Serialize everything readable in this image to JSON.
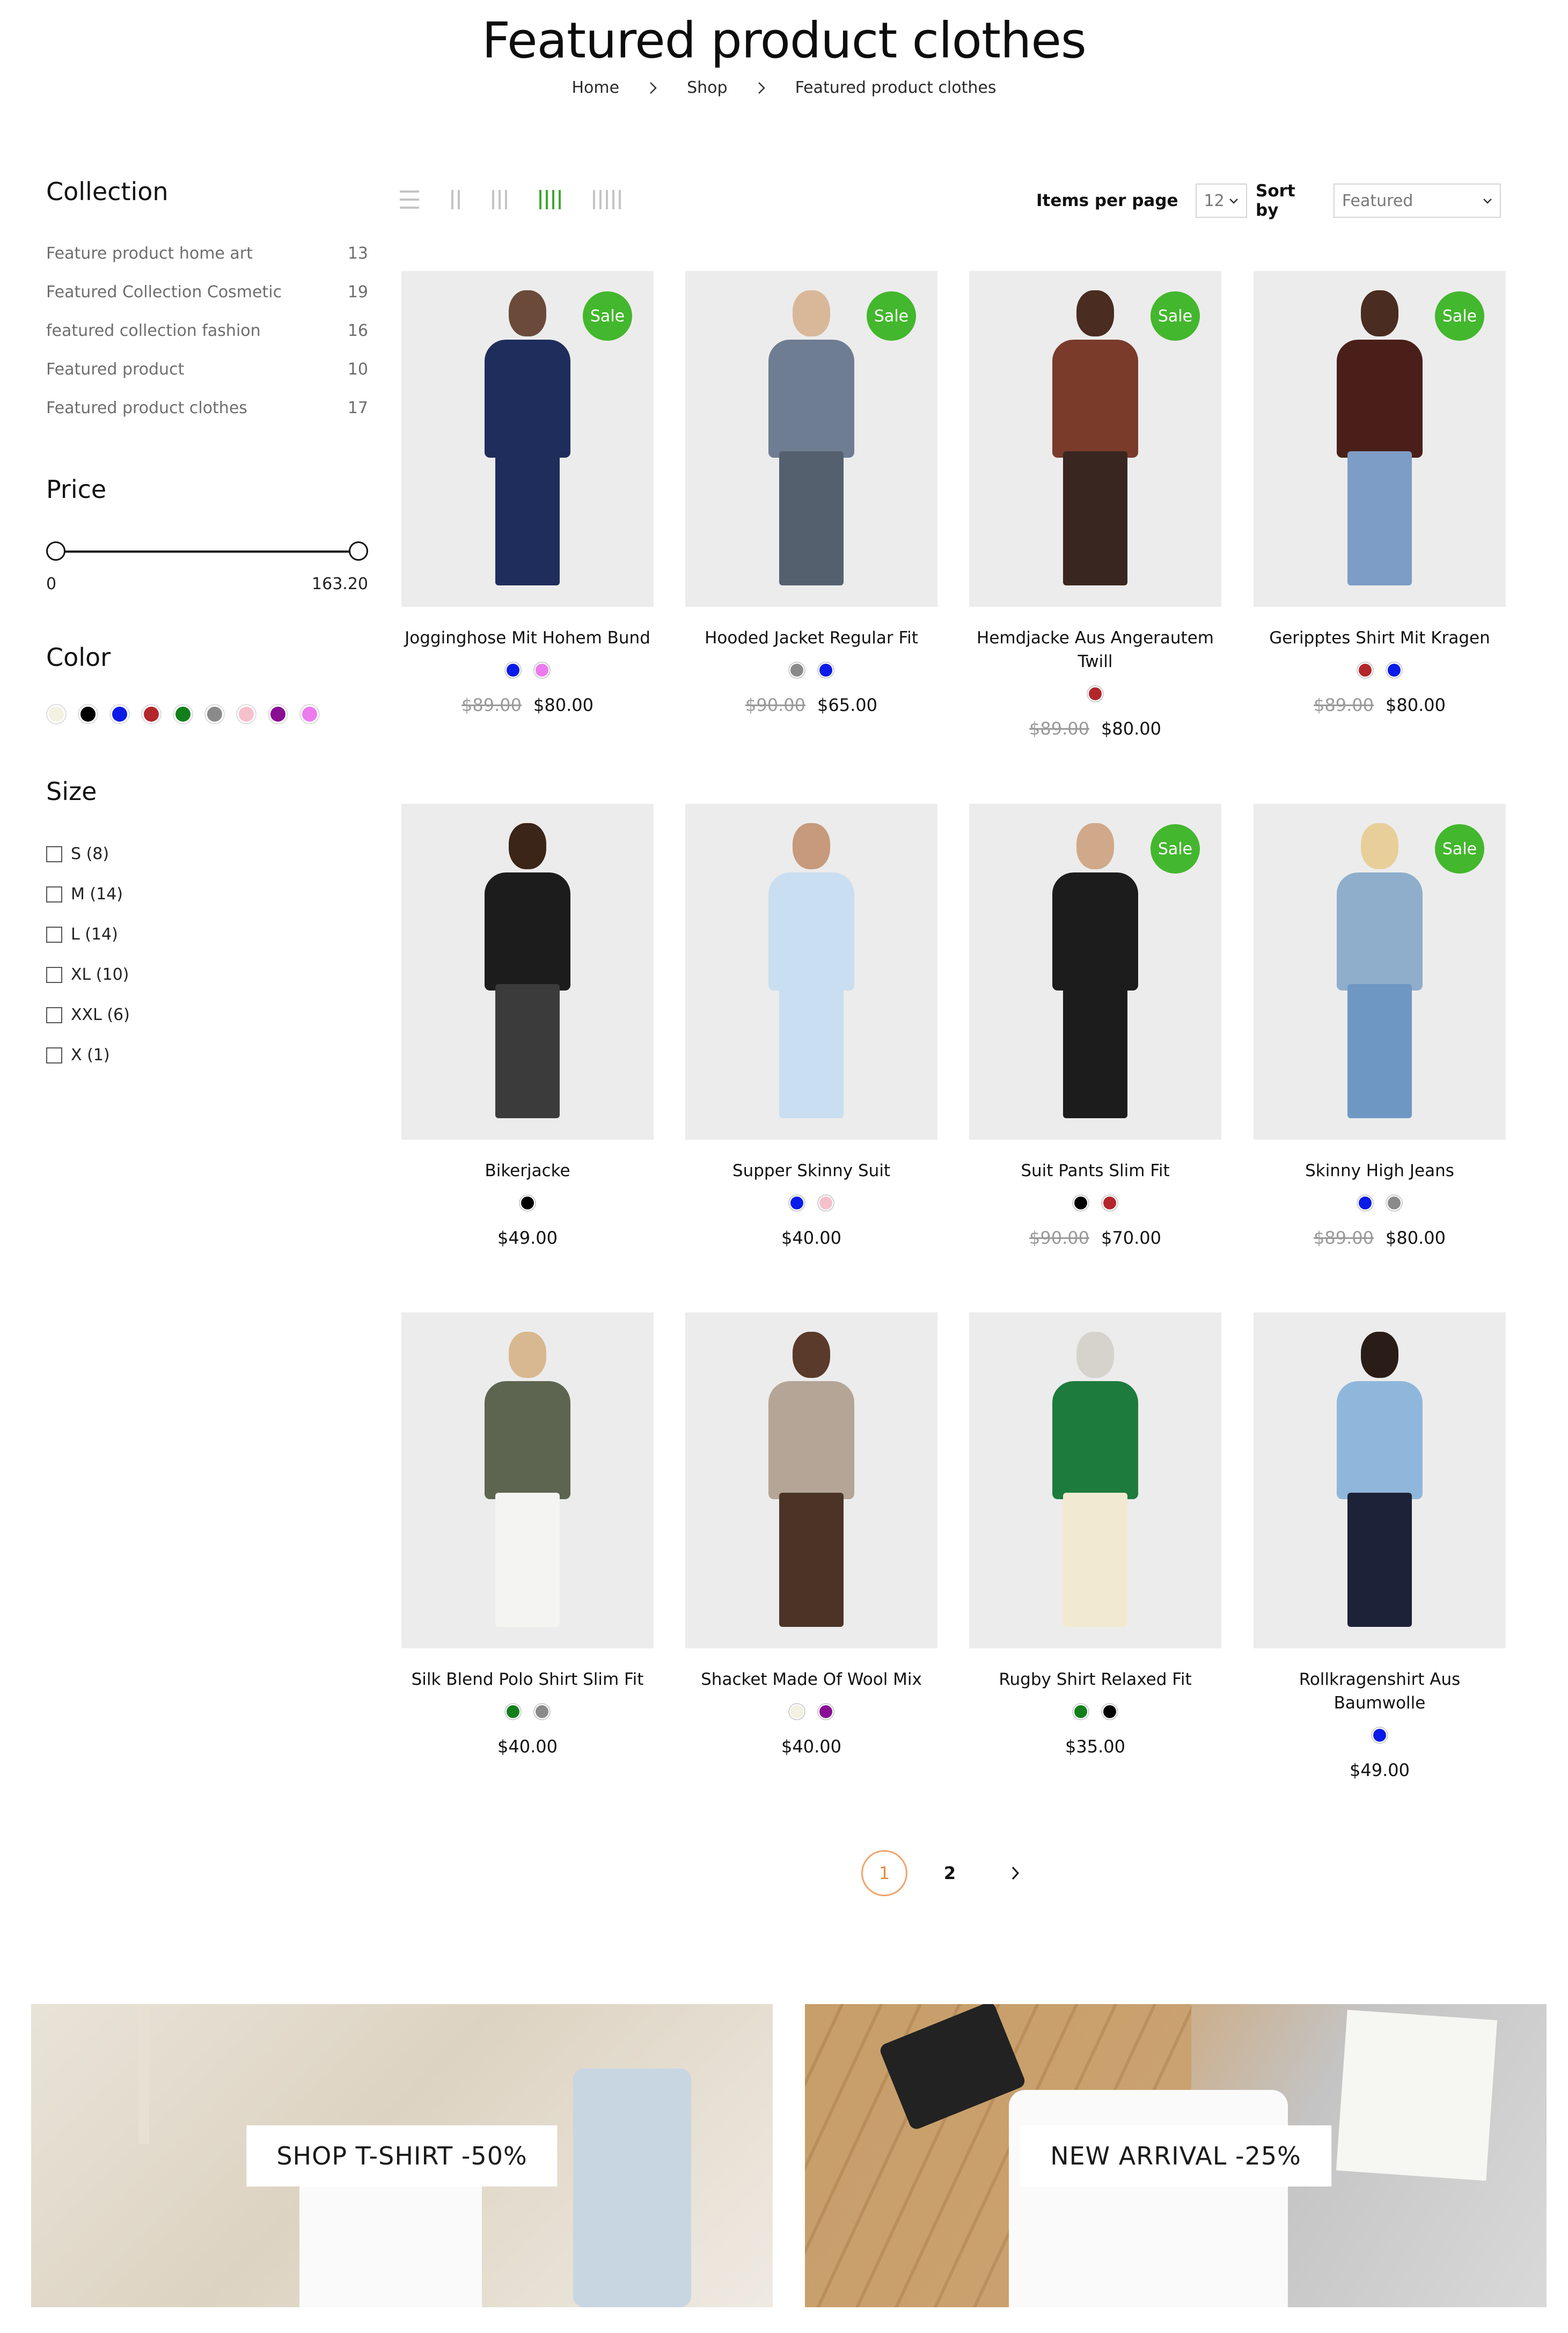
{
  "header": {
    "title": "Featured product clothes",
    "breadcrumb": [
      "Home",
      "Shop",
      "Featured product clothes"
    ]
  },
  "sidebar": {
    "collection": {
      "heading": "Collection",
      "items": [
        {
          "label": "Feature product home art",
          "count": "13"
        },
        {
          "label": "Featured Collection Cosmetic",
          "count": "19"
        },
        {
          "label": "featured collection fashion",
          "count": "16"
        },
        {
          "label": "Featured product",
          "count": "10"
        },
        {
          "label": "Featured product clothes",
          "count": "17"
        }
      ]
    },
    "price": {
      "heading": "Price",
      "min": "0",
      "max": "163.20"
    },
    "color": {
      "heading": "Color",
      "swatches": [
        "#f3f1df",
        "#000000",
        "#0a1be8",
        "#b3262b",
        "#11801a",
        "#8a8a8a",
        "#f6bfcc",
        "#8a0d93",
        "#ec7bee"
      ]
    },
    "size": {
      "heading": "Size",
      "items": [
        "S (8)",
        "M (14)",
        "L (14)",
        "XL (10)",
        "XXL (6)",
        "X (1)"
      ]
    }
  },
  "toolbar": {
    "items_per_page_label": "Items per page",
    "items_per_page_value": "12",
    "sort_label": "Sort by",
    "sort_value": "Featured",
    "active_view": "4-columns",
    "accent": "#3ca82e"
  },
  "products": [
    {
      "name": "Jogginghose Mit Hohem Bund",
      "sale": "Sale",
      "old_price": "$89.00",
      "price": "$80.00",
      "swatches": [
        "#0a1be8",
        "#ec7bee"
      ],
      "palette": [
        "#6b4a3a",
        "#1f2d5c",
        "#1f2d5c"
      ]
    },
    {
      "name": "Hooded Jacket Regular Fit",
      "sale": "Sale",
      "old_price": "$90.00",
      "price": "$65.00",
      "swatches": [
        "#8a8a8a",
        "#0a1be8"
      ],
      "palette": [
        "#d9b89a",
        "#6f7d92",
        "#55606f"
      ]
    },
    {
      "name": "Hemdjacke Aus Angerautem Twill",
      "sale": "Sale",
      "old_price": "$89.00",
      "price": "$80.00",
      "swatches": [
        "#b3262b"
      ],
      "palette": [
        "#4a2c20",
        "#7a3b2a",
        "#3a2620"
      ]
    },
    {
      "name": "Geripptes Shirt Mit Kragen",
      "sale": "Sale",
      "old_price": "$89.00",
      "price": "$80.00",
      "swatches": [
        "#b3262b",
        "#0a1be8"
      ],
      "palette": [
        "#4a2c20",
        "#4a1f1a",
        "#7d9cc6"
      ]
    },
    {
      "name": "Bikerjacke",
      "sale": "",
      "old_price": "",
      "price": "$49.00",
      "swatches": [
        "#000000"
      ],
      "palette": [
        "#3b2418",
        "#1c1c1c",
        "#3b3b3b"
      ]
    },
    {
      "name": "Supper Skinny Suit",
      "sale": "",
      "old_price": "",
      "price": "$40.00",
      "swatches": [
        "#0a1be8",
        "#f6bfcc"
      ],
      "palette": [
        "#c69a7b",
        "#c9def0",
        "#c9def0"
      ]
    },
    {
      "name": "Suit Pants Slim Fit",
      "sale": "Sale",
      "old_price": "$90.00",
      "price": "$70.00",
      "swatches": [
        "#000000",
        "#b3262b"
      ],
      "palette": [
        "#d0a98a",
        "#1c1c1c",
        "#1c1c1c"
      ]
    },
    {
      "name": "Skinny High Jeans",
      "sale": "Sale",
      "old_price": "$89.00",
      "price": "$80.00",
      "swatches": [
        "#0a1be8",
        "#8a8a8a"
      ],
      "palette": [
        "#e8cf9a",
        "#8eaecb",
        "#6f97c4"
      ]
    },
    {
      "name": "Silk Blend Polo Shirt Slim Fit",
      "sale": "",
      "old_price": "",
      "price": "$40.00",
      "swatches": [
        "#11801a",
        "#8a8a8a"
      ],
      "palette": [
        "#d8b890",
        "#5d6450",
        "#f4f4f2"
      ]
    },
    {
      "name": "Shacket Made Of Wool Mix",
      "sale": "",
      "old_price": "",
      "price": "$40.00",
      "swatches": [
        "#f3f1df",
        "#8a0d93"
      ],
      "palette": [
        "#5a3a2a",
        "#b4a596",
        "#4b3426"
      ]
    },
    {
      "name": "Rugby Shirt Relaxed Fit",
      "sale": "",
      "old_price": "",
      "price": "$35.00",
      "swatches": [
        "#11801a",
        "#000000"
      ],
      "palette": [
        "#d6d3cd",
        "#1d7b3d",
        "#f1ead0"
      ]
    },
    {
      "name": "Rollkragenshirt Aus Baumwolle",
      "sale": "",
      "old_price": "",
      "price": "$49.00",
      "swatches": [
        "#0a1be8"
      ],
      "palette": [
        "#2a1d17",
        "#8fb7dc",
        "#1e2238"
      ]
    }
  ],
  "pagination": {
    "pages": [
      "1",
      "2"
    ],
    "current": "1"
  },
  "banners": [
    {
      "label": "SHOP T-SHIRT -50%"
    },
    {
      "label": "NEW ARRIVAL -25%"
    }
  ]
}
